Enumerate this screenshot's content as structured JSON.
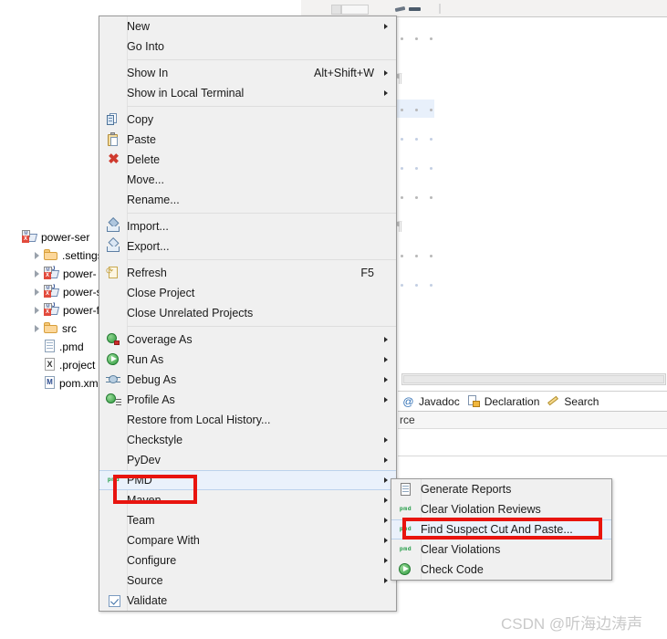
{
  "watermark": "CSDN @听海边涛声",
  "explorer": {
    "nodes": [
      {
        "label": "power-ser",
        "icon": "maven-java-project-icon",
        "twisty": false,
        "selected": true
      },
      {
        "label": ".settings",
        "icon": "folder-icon",
        "twisty": true,
        "selected": false
      },
      {
        "label": "power-",
        "icon": "maven-java-project-icon",
        "twisty": true,
        "selected": false
      },
      {
        "label": "power-s",
        "icon": "maven-java-project-icon",
        "twisty": true,
        "selected": false
      },
      {
        "label": "power-f",
        "icon": "maven-java-project-icon",
        "twisty": true,
        "selected": false
      },
      {
        "label": "src",
        "icon": "folder-icon",
        "twisty": true,
        "selected": false
      },
      {
        "label": ".pmd",
        "icon": "file-doc-icon",
        "twisty": false,
        "selected": false
      },
      {
        "label": ".project",
        "icon": "file-x-icon",
        "twisty": false,
        "selected": false
      },
      {
        "label": "pom.xm",
        "icon": "file-m-icon",
        "twisty": false,
        "selected": false
      }
    ],
    "file_icon_letters": {
      "project": "X",
      "pom": "M"
    }
  },
  "views": {
    "tabs": [
      {
        "label": "Javadoc",
        "icon": "at-sign-icon"
      },
      {
        "label": "Declaration",
        "icon": "declaration-icon"
      },
      {
        "label": "Search",
        "icon": "search-pencil-icon"
      }
    ],
    "breadcrumb": "rce"
  },
  "context_menu": {
    "items": [
      {
        "label": "New",
        "icon": "",
        "accel": "",
        "arrow": true,
        "sep_after": false
      },
      {
        "label": "Go Into",
        "icon": "",
        "accel": "",
        "arrow": false,
        "sep_after": true
      },
      {
        "label": "Show In",
        "icon": "",
        "accel": "Alt+Shift+W",
        "arrow": true,
        "sep_after": false
      },
      {
        "label": "Show in Local Terminal",
        "icon": "",
        "accel": "",
        "arrow": true,
        "sep_after": true
      },
      {
        "label": "Copy",
        "icon": "copy-icon",
        "accel": "",
        "arrow": false,
        "sep_after": false
      },
      {
        "label": "Paste",
        "icon": "paste-icon",
        "accel": "",
        "arrow": false,
        "sep_after": false
      },
      {
        "label": "Delete",
        "icon": "delete-icon",
        "accel": "",
        "arrow": false,
        "sep_after": false
      },
      {
        "label": "Move...",
        "icon": "",
        "accel": "",
        "arrow": false,
        "sep_after": false
      },
      {
        "label": "Rename...",
        "icon": "",
        "accel": "",
        "arrow": false,
        "sep_after": true
      },
      {
        "label": "Import...",
        "icon": "import-icon",
        "accel": "",
        "arrow": false,
        "sep_after": false
      },
      {
        "label": "Export...",
        "icon": "export-icon",
        "accel": "",
        "arrow": false,
        "sep_after": true
      },
      {
        "label": "Refresh",
        "icon": "refresh-icon",
        "accel": "F5",
        "arrow": false,
        "sep_after": false
      },
      {
        "label": "Close Project",
        "icon": "",
        "accel": "",
        "arrow": false,
        "sep_after": false
      },
      {
        "label": "Close Unrelated Projects",
        "icon": "",
        "accel": "",
        "arrow": false,
        "sep_after": true
      },
      {
        "label": "Coverage As",
        "icon": "coverage-icon",
        "accel": "",
        "arrow": true,
        "sep_after": false
      },
      {
        "label": "Run As",
        "icon": "run-icon",
        "accel": "",
        "arrow": true,
        "sep_after": false
      },
      {
        "label": "Debug As",
        "icon": "debug-icon",
        "accel": "",
        "arrow": true,
        "sep_after": false
      },
      {
        "label": "Profile As",
        "icon": "profile-icon",
        "accel": "",
        "arrow": true,
        "sep_after": false
      },
      {
        "label": "Restore from Local History...",
        "icon": "",
        "accel": "",
        "arrow": false,
        "sep_after": false
      },
      {
        "label": "Checkstyle",
        "icon": "",
        "accel": "",
        "arrow": true,
        "sep_after": false
      },
      {
        "label": "PyDev",
        "icon": "",
        "accel": "",
        "arrow": true,
        "sep_after": false
      },
      {
        "label": "PMD",
        "icon": "pmd-icon",
        "accel": "",
        "arrow": true,
        "sep_after": false,
        "highlighted": true
      },
      {
        "label": "Maven",
        "icon": "",
        "accel": "",
        "arrow": true,
        "sep_after": false
      },
      {
        "label": "Team",
        "icon": "",
        "accel": "",
        "arrow": true,
        "sep_after": false
      },
      {
        "label": "Compare With",
        "icon": "",
        "accel": "",
        "arrow": true,
        "sep_after": false
      },
      {
        "label": "Configure",
        "icon": "",
        "accel": "",
        "arrow": true,
        "sep_after": false
      },
      {
        "label": "Source",
        "icon": "",
        "accel": "",
        "arrow": true,
        "sep_after": false
      },
      {
        "label": "Validate",
        "icon": "checkbox-checked-icon",
        "accel": "",
        "arrow": false,
        "sep_after": false
      }
    ],
    "pmd_icon_text": "pmd"
  },
  "pmd_submenu": {
    "items": [
      {
        "label": "Generate Reports",
        "icon": "report-icon",
        "highlighted": false
      },
      {
        "label": "Clear Violation Reviews",
        "icon": "pmd-icon",
        "highlighted": false
      },
      {
        "label": "Find Suspect Cut And Paste...",
        "icon": "pmd-icon",
        "highlighted": true
      },
      {
        "label": "Clear Violations",
        "icon": "pmd-icon",
        "highlighted": false
      },
      {
        "label": "Check Code",
        "icon": "run-icon",
        "highlighted": false
      }
    ]
  },
  "annotations": {
    "accent_color": "#e8140f",
    "highlight_color": "#eaf1fb",
    "targets": [
      "PMD",
      "Find Suspect Cut And Paste..."
    ]
  }
}
